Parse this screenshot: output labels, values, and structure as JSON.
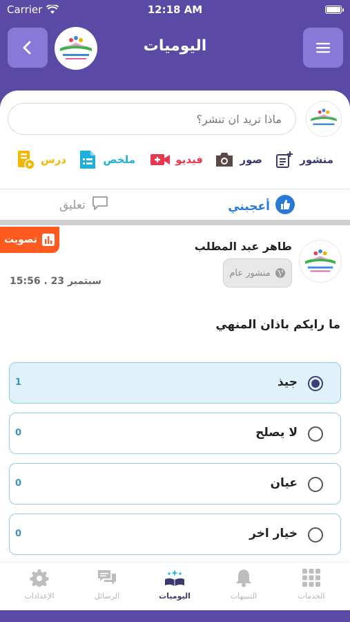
{
  "status_bar": {
    "carrier": "Carrier",
    "time": "12:18 AM"
  },
  "header": {
    "title": "اليوميات",
    "back_icon": "chevron-left-icon",
    "menu_icon": "hamburger-icon"
  },
  "composer": {
    "placeholder": "ماذا تريد ان تنشر؟",
    "value": ""
  },
  "post_types": [
    {
      "label": "منشور",
      "icon": "post-add-icon",
      "color": "#3a3a6e"
    },
    {
      "label": "صور",
      "icon": "camera-icon",
      "color": "#3a3a6e"
    },
    {
      "label": "فيديو",
      "icon": "video-icon",
      "color": "#e8364f"
    },
    {
      "label": "ملخص",
      "icon": "summary-icon",
      "color": "#1db0d8"
    },
    {
      "label": "درس",
      "icon": "lesson-icon",
      "color": "#f3b700"
    }
  ],
  "reactions": {
    "like": "أعجبني",
    "comment": "تعليق",
    "like_color": "#2979d8"
  },
  "post": {
    "tag": "تصويت",
    "author": "طاهر عبد المطلب",
    "privacy": "منشور عام",
    "date": "سبتمبر 23 .  15:56",
    "question": "ما رايكم باذان المنهي",
    "options": [
      {
        "label": "جيذ",
        "count": "1",
        "selected": true
      },
      {
        "label": "لا يصلح",
        "count": "0",
        "selected": false
      },
      {
        "label": "عيان",
        "count": "0",
        "selected": false
      },
      {
        "label": "خيار اخر",
        "count": "0",
        "selected": false
      }
    ]
  },
  "tabs": [
    {
      "label": "الإعدادات",
      "icon": "gear-icon",
      "active": false
    },
    {
      "label": "الرسائل",
      "icon": "chat-icon",
      "active": false
    },
    {
      "label": "اليوميات",
      "icon": "book-sparkle-icon",
      "active": true
    },
    {
      "label": "التنبيهات",
      "icon": "bell-icon",
      "active": false
    },
    {
      "label": "الخدمات",
      "icon": "grid-icon",
      "active": false
    }
  ],
  "colors": {
    "brand": "#5a4aa6",
    "button": "#8878d8",
    "vote_tag": "#ff5a1f",
    "option_border": "#8fcde6"
  }
}
